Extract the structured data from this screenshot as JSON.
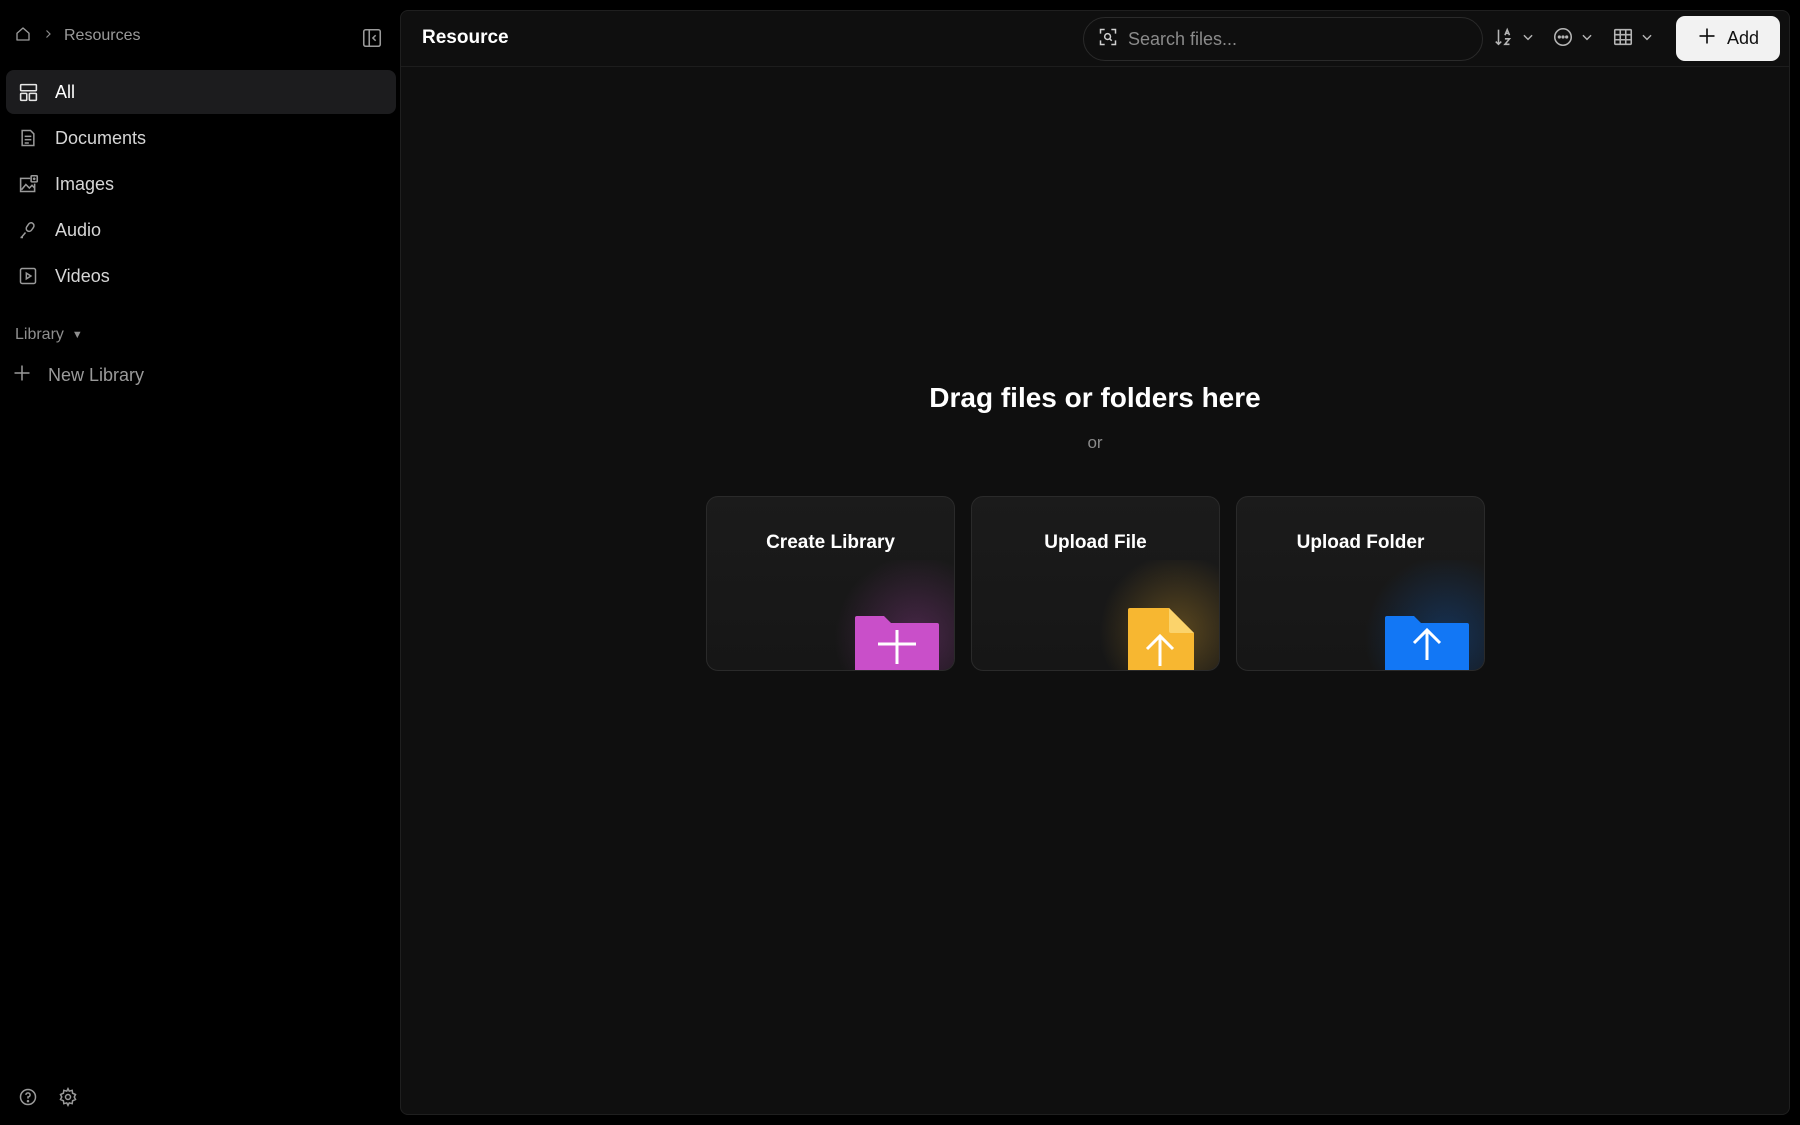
{
  "breadcrumb": {
    "current": "Resources"
  },
  "sidebar": {
    "items": [
      {
        "label": "All",
        "icon": "layout-icon",
        "active": true
      },
      {
        "label": "Documents",
        "icon": "document-icon",
        "active": false
      },
      {
        "label": "Images",
        "icon": "images-icon",
        "active": false
      },
      {
        "label": "Audio",
        "icon": "microphone-icon",
        "active": false
      },
      {
        "label": "Videos",
        "icon": "video-icon",
        "active": false
      }
    ],
    "library_label": "Library",
    "new_library_label": "New Library"
  },
  "header": {
    "title": "Resource",
    "search_placeholder": "Search files...",
    "add_label": "Add"
  },
  "drop": {
    "title": "Drag files or folders here",
    "or": "or"
  },
  "cards": [
    {
      "label": "Create Library",
      "color": "#c94fc9"
    },
    {
      "label": "Upload File",
      "color": "#f7b731"
    },
    {
      "label": "Upload Folder",
      "color": "#1277f5"
    }
  ],
  "colors": {
    "background": "#000000",
    "panel": "#0f0f0f",
    "active_item": "#1c1c1e",
    "accent_button": "#f2f2f2"
  }
}
